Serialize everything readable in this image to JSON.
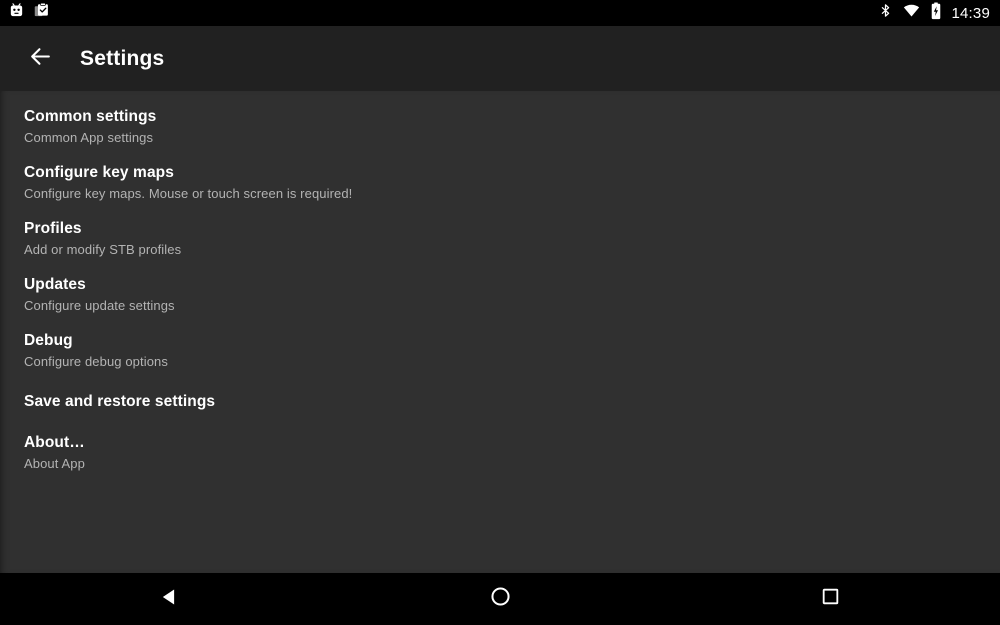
{
  "statusbar": {
    "notification_icons": [
      {
        "name": "robot-face-icon"
      },
      {
        "name": "clipboard-check-icon"
      }
    ],
    "system_icons": [
      {
        "name": "bluetooth-icon"
      },
      {
        "name": "wifi-icon"
      },
      {
        "name": "battery-charging-icon"
      }
    ],
    "time": "14:39"
  },
  "toolbar": {
    "back_icon": "arrow-back-icon",
    "title": "Settings"
  },
  "settings": {
    "items": [
      {
        "title": "Common settings",
        "summary": "Common App settings"
      },
      {
        "title": "Configure key maps",
        "summary": "Configure key maps. Mouse or touch screen is required!"
      },
      {
        "title": "Profiles",
        "summary": "Add or modify STB profiles"
      },
      {
        "title": "Updates",
        "summary": "Configure update settings"
      },
      {
        "title": "Debug",
        "summary": "Configure debug options"
      },
      {
        "title": "Save and restore settings",
        "summary": ""
      },
      {
        "title": "About…",
        "summary": "About App"
      }
    ]
  },
  "navbar": {
    "back_label": "back-triangle-icon",
    "home_label": "home-circle-icon",
    "recents_label": "recents-square-icon"
  },
  "colors": {
    "status_bar_bg": "#000000",
    "toolbar_bg": "#212121",
    "content_bg": "#303030",
    "nav_bar_bg": "#000000",
    "title_text": "#ffffff",
    "summary_text": "#b3b3b3"
  }
}
